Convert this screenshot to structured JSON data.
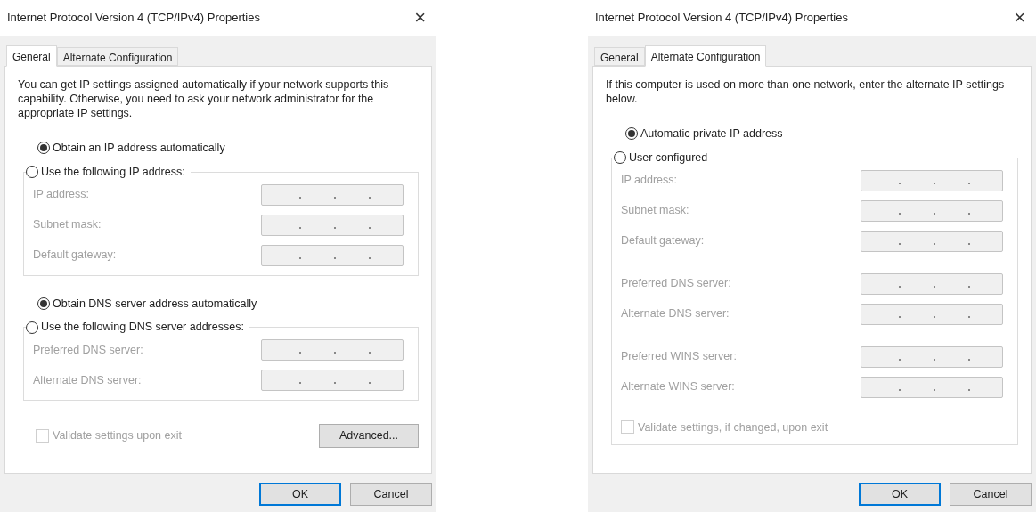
{
  "dialogs": [
    {
      "title": "Internet Protocol Version 4 (TCP/IPv4) Properties",
      "close": "×",
      "tabs": [
        {
          "label": "General",
          "selected": true
        },
        {
          "label": "Alternate Configuration",
          "selected": false
        }
      ],
      "intro": "You can get IP settings assigned automatically if your network supports this capability. Otherwise, you need to ask your network administrator for the appropriate IP settings.",
      "sections": [
        {
          "kind": "radio",
          "label": "Obtain an IP address automatically",
          "selected": true
        },
        {
          "kind": "group",
          "label": "Use the following IP address:",
          "selected": false,
          "disabled": true,
          "blocks": [
            [
              "IP address:",
              "Subnet mask:",
              "Default gateway:"
            ]
          ]
        },
        {
          "kind": "radio",
          "label": "Obtain DNS server address automatically",
          "selected": true
        },
        {
          "kind": "group",
          "label": "Use the following DNS server addresses:",
          "selected": false,
          "disabled": true,
          "blocks": [
            [
              "Preferred DNS server:",
              "Alternate DNS server:"
            ]
          ]
        }
      ],
      "checkbox": {
        "label": "Validate settings upon exit",
        "checked": false,
        "disabled": true
      },
      "advanced_button": "Advanced...",
      "buttons": [
        {
          "label": "OK",
          "default": true
        },
        {
          "label": "Cancel",
          "default": false
        }
      ]
    },
    {
      "title": "Internet Protocol Version 4 (TCP/IPv4) Properties",
      "close": "×",
      "tabs": [
        {
          "label": "General",
          "selected": false
        },
        {
          "label": "Alternate Configuration",
          "selected": true
        }
      ],
      "intro": "If this computer is used on more than one network, enter the alternate IP settings below.",
      "sections": [
        {
          "kind": "radio",
          "label": "Automatic private IP address",
          "selected": true
        },
        {
          "kind": "group",
          "label": "User configured",
          "selected": false,
          "disabled": true,
          "blocks": [
            [
              "IP address:",
              "Subnet mask:",
              "Default gateway:"
            ],
            [
              "Preferred DNS server:",
              "Alternate DNS server:"
            ],
            [
              "Preferred WINS server:",
              "Alternate WINS server:"
            ]
          ],
          "checkbox": {
            "label": "Validate settings, if changed, upon exit",
            "checked": false,
            "disabled": true
          }
        }
      ],
      "buttons": [
        {
          "label": "OK",
          "default": true
        },
        {
          "label": "Cancel",
          "default": false
        }
      ]
    }
  ]
}
